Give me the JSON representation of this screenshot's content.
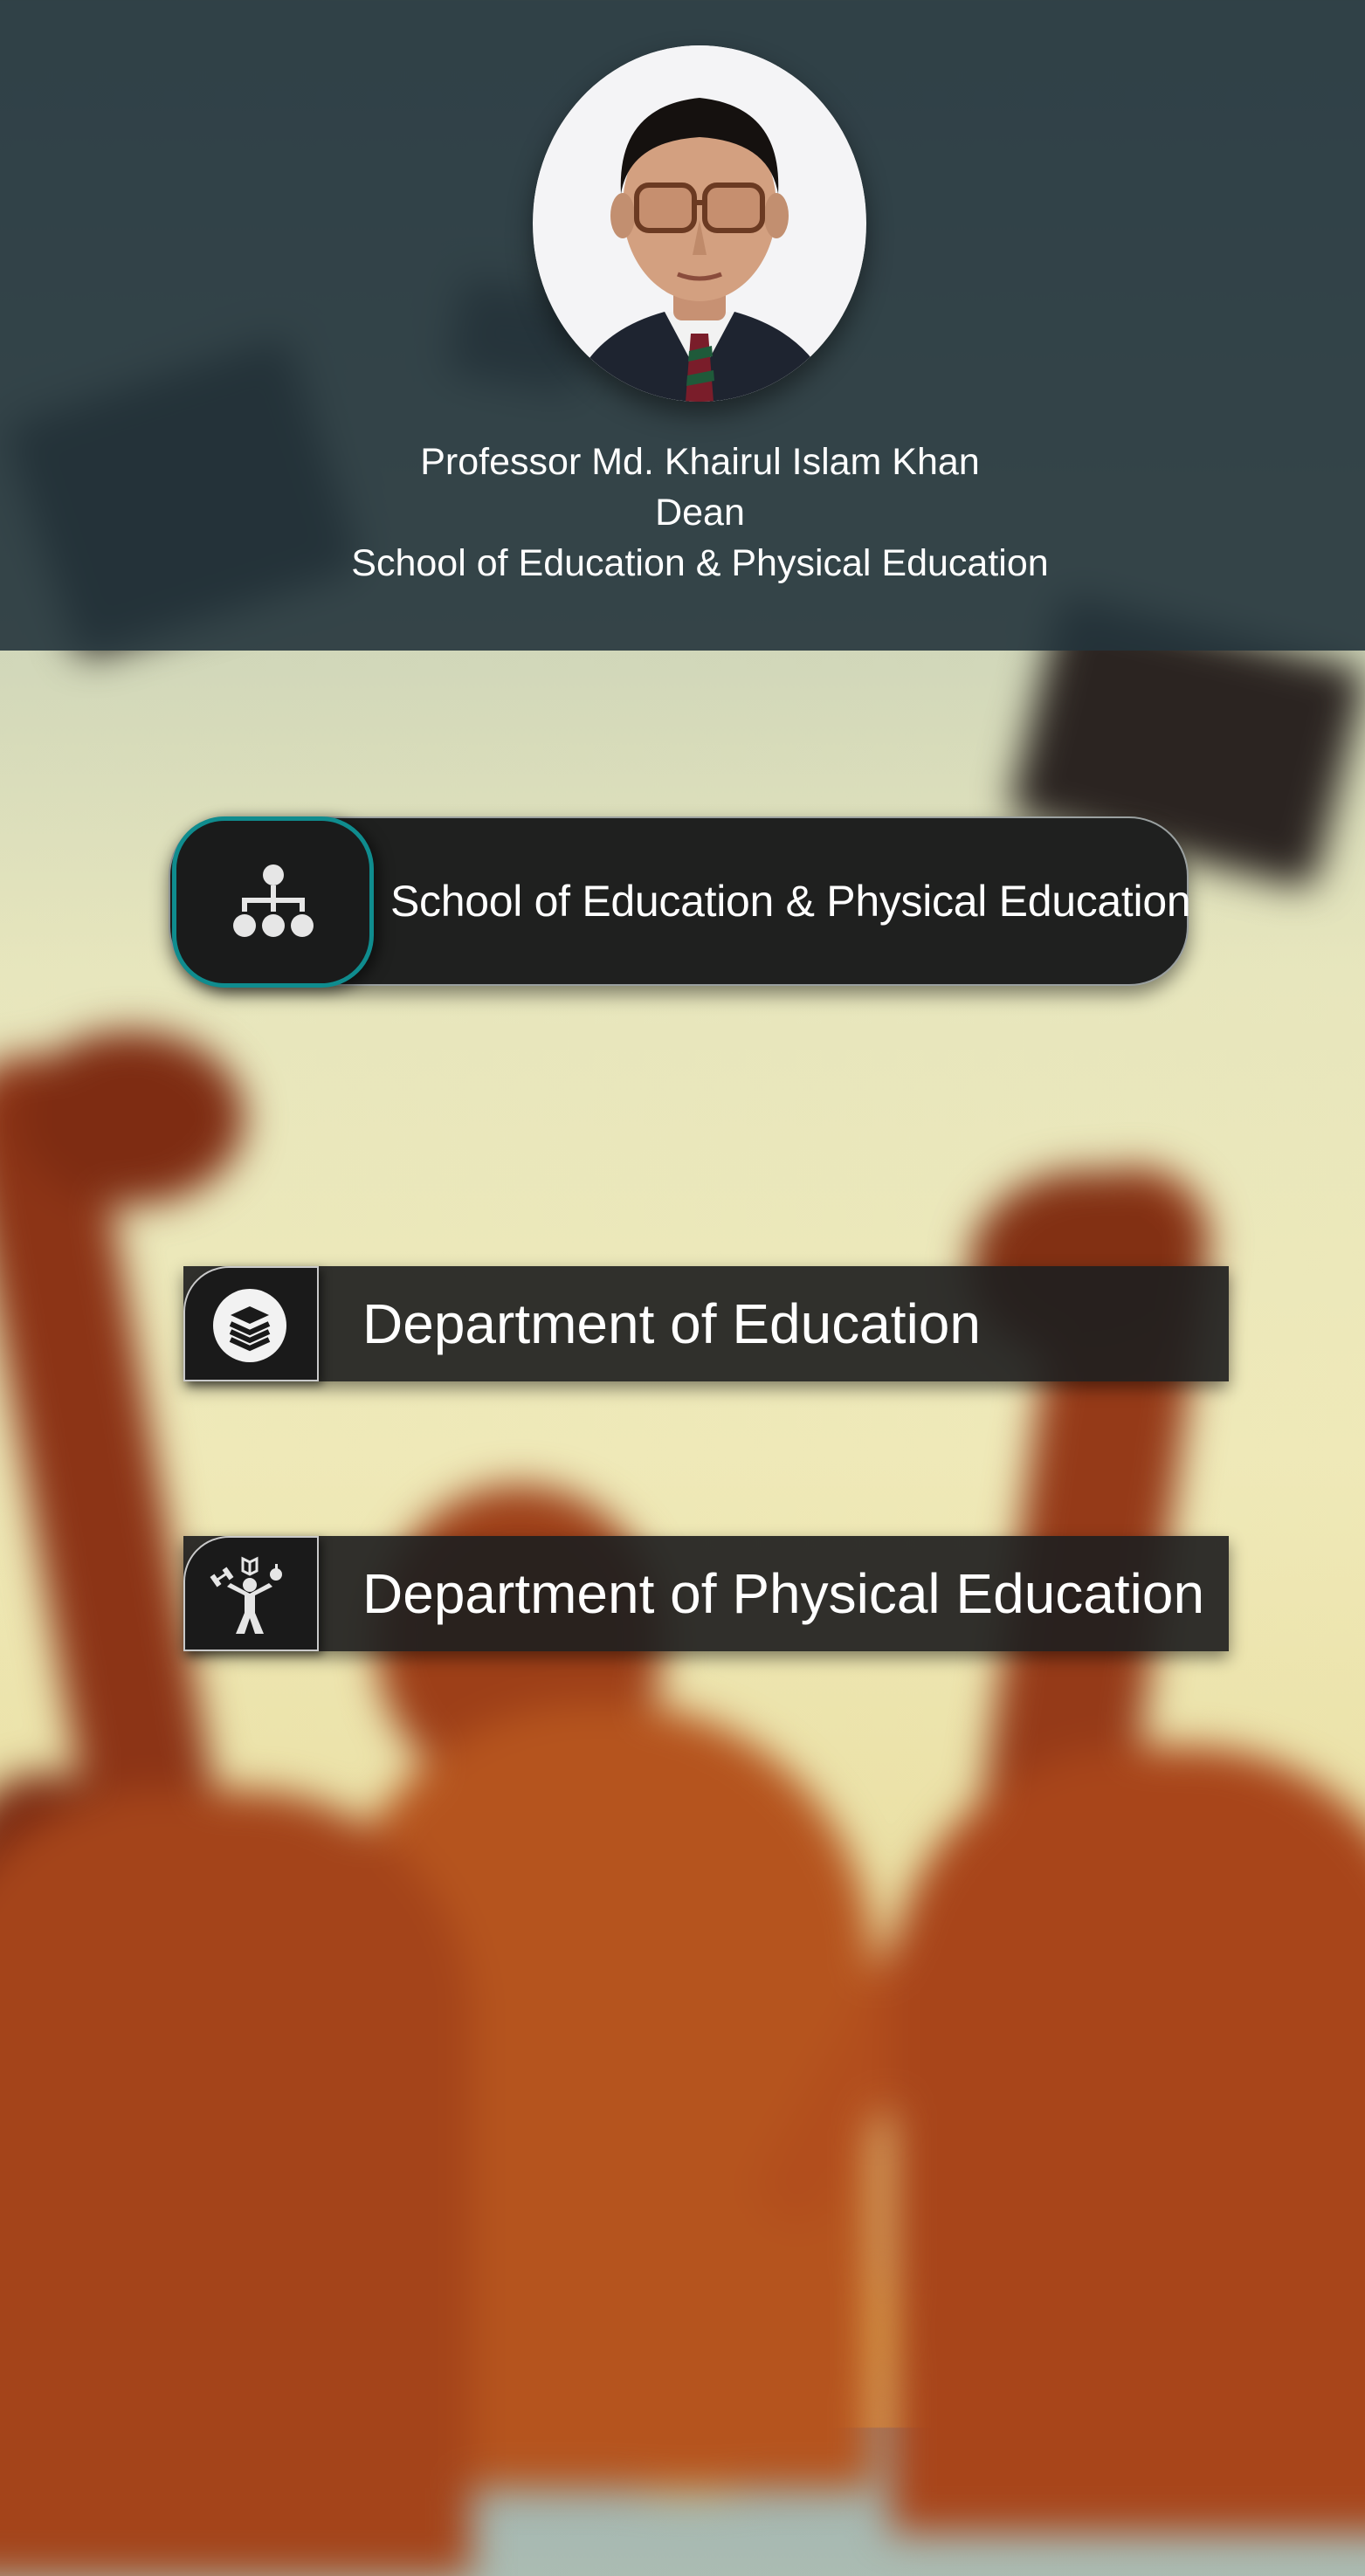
{
  "header": {
    "name": "Professor Md. Khairul Islam Khan",
    "title": "Dean",
    "school": "School of Education & Physical Education"
  },
  "nav": {
    "school_button": {
      "label": "School of Education & Physical Education",
      "icon": "hierarchy-icon"
    },
    "departments": [
      {
        "label": "Department of Education",
        "icon": "books-icon"
      },
      {
        "label": "Department of Physical Education",
        "icon": "athlete-icon"
      }
    ]
  },
  "colors": {
    "header_bg": "#23343c",
    "button_bg": "#1f201f",
    "accent_teal": "#0f8c8e",
    "text": "#ffffff"
  }
}
